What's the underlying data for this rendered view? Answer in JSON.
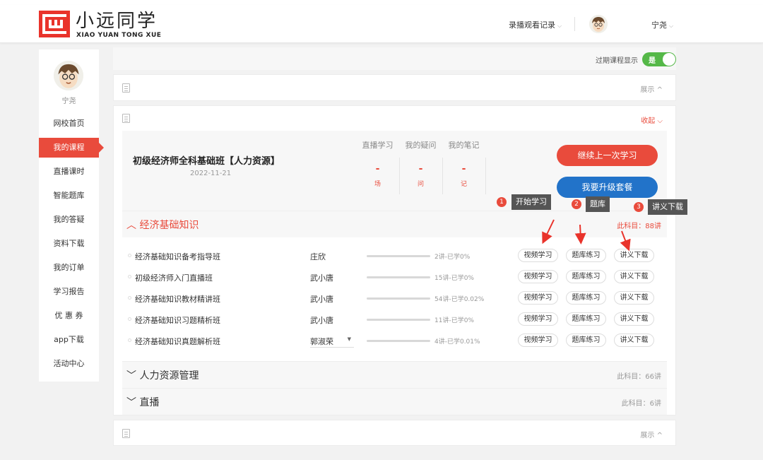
{
  "header": {
    "logo_cn": "小远同学",
    "logo_en": "XIAO YUAN TONG XUE",
    "record_link": "录播观看记录",
    "user_name": "宁尧"
  },
  "sidebar": {
    "user_name": "宁尧",
    "active_index": 1,
    "items": [
      "网校首页",
      "我的课程",
      "直播课时",
      "智能题库",
      "我的答疑",
      "资料下载",
      "我的订单",
      "学习报告",
      "优 惠 券",
      "app下载",
      "活动中心"
    ]
  },
  "expire": {
    "label": "过期课程显示",
    "toggle_text": "是",
    "on": true
  },
  "cards": {
    "top_toggle": "展示",
    "main_toggle": "收起",
    "bottom_toggle": "展示"
  },
  "course": {
    "title": "初级经济师全科基础班【人力资源】",
    "date": "2022-11-21",
    "stats": [
      {
        "label": "直播学习",
        "value": "-",
        "unit": "场"
      },
      {
        "label": "我的疑问",
        "value": "-",
        "unit": "问"
      },
      {
        "label": "我的笔记",
        "value": "-",
        "unit": "记"
      }
    ],
    "continue_button": "继续上一次学习",
    "upgrade_button": "我要升级套餐"
  },
  "callouts": [
    {
      "num": "1",
      "text": "开始学习"
    },
    {
      "num": "2",
      "text": "题库"
    },
    {
      "num": "3",
      "text": "讲义下载"
    }
  ],
  "section_open": {
    "title": "经济基础知识",
    "count": "此科目：88讲"
  },
  "lessons": [
    {
      "name": "经济基础知识备考指导班",
      "teacher": "庄欣",
      "progress": "2讲-已学0%",
      "pct": 0,
      "dropdown": false
    },
    {
      "name": "初级经济师入门直播班",
      "teacher": "武小唐",
      "progress": "15讲-已学0%",
      "pct": 0,
      "dropdown": false
    },
    {
      "name": "经济基础知识教材精讲班",
      "teacher": "武小唐",
      "progress": "54讲-已学0.02%",
      "pct": 0.02,
      "dropdown": false
    },
    {
      "name": "经济基础知识习题精析班",
      "teacher": "武小唐",
      "progress": "11讲-已学0%",
      "pct": 0,
      "dropdown": false
    },
    {
      "name": "经济基础知识真题解析班",
      "teacher": "郭淑荣",
      "progress": "4讲-已学0.01%",
      "pct": 0.01,
      "dropdown": true
    }
  ],
  "lesson_buttons": {
    "video": "视频学习",
    "quiz": "题库练习",
    "notes": "讲义下载"
  },
  "sections_closed": [
    {
      "title": "人力资源管理",
      "count": "此科目：66讲"
    },
    {
      "title": "直播",
      "count": "此科目：6讲"
    }
  ]
}
